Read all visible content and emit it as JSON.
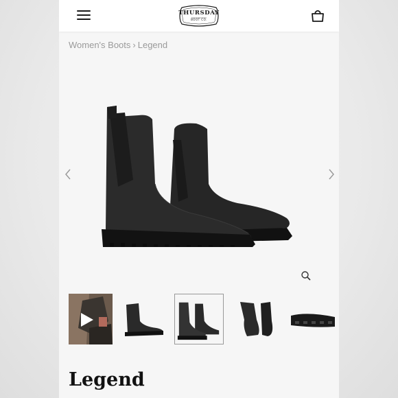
{
  "header": {
    "logo_main": "THURSDAY",
    "logo_sub": "BOOT CO.",
    "menu_icon": "hamburger-menu-icon",
    "bag_icon": "shopping-bag-icon"
  },
  "breadcrumb": {
    "items": [
      "Women's Boots",
      "Legend"
    ],
    "separator": "›"
  },
  "gallery": {
    "prev_icon": "chevron-left-icon",
    "next_icon": "chevron-right-icon",
    "zoom_icon": "magnifier-icon",
    "thumbnails": [
      "video",
      "side-view",
      "front-pair",
      "top-view",
      "sole-view"
    ],
    "selected_thumbnail": 2
  },
  "product": {
    "title": "Legend"
  },
  "colors": {
    "text": "#111111",
    "breadcrumb": "#9a9a9a",
    "boot": "#1f1f1f",
    "background": "#f6f6f6"
  }
}
